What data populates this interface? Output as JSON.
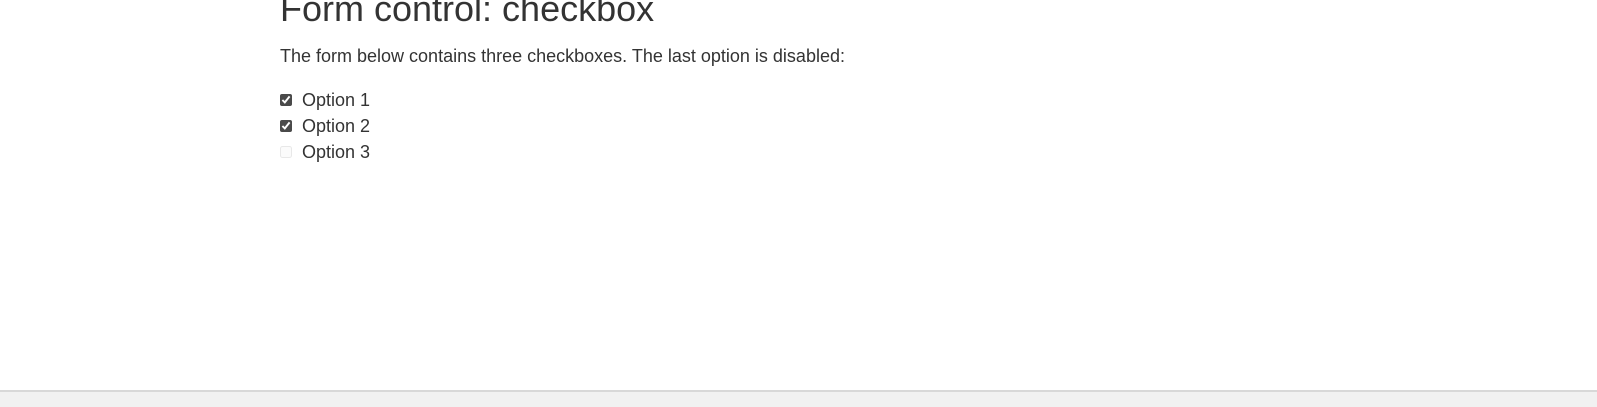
{
  "page": {
    "title": "Form control: checkbox",
    "description": "The form below contains three checkboxes. The last option is disabled:"
  },
  "form": {
    "options": [
      {
        "label": "Option 1",
        "checked": true,
        "disabled": false
      },
      {
        "label": "Option 2",
        "checked": true,
        "disabled": false
      },
      {
        "label": "Option 3",
        "checked": false,
        "disabled": true
      }
    ]
  }
}
